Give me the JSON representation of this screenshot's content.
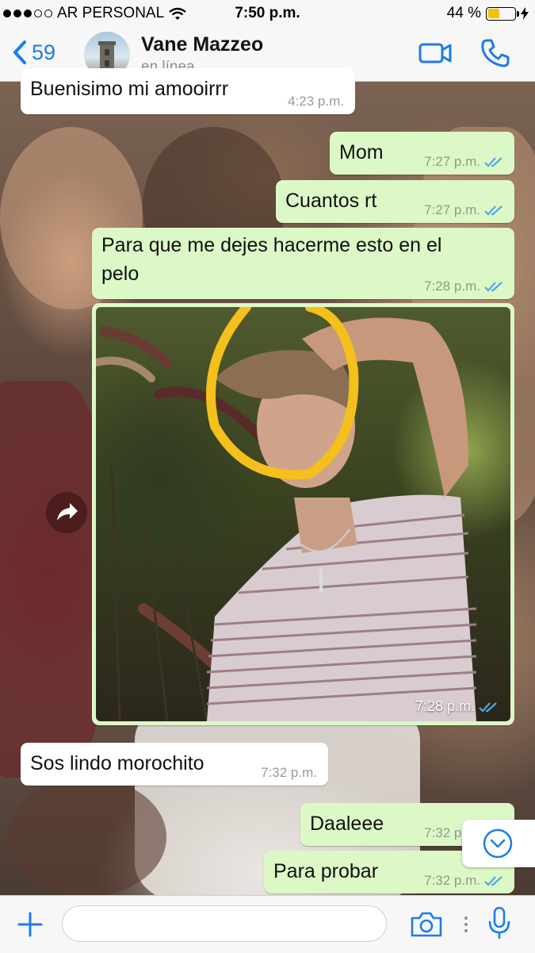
{
  "status_bar": {
    "carrier": "AR PERSONAL",
    "time": "7:50 p.m.",
    "battery": "44 %",
    "battery_level": 0.44,
    "signal_bars": 3
  },
  "header": {
    "back_count": "59",
    "contact_name": "Vane Mazzeo",
    "contact_status": "en línea"
  },
  "messages": [
    {
      "direction": "in",
      "text": "Buenisimo mi amooirrr",
      "time": "4:23 p.m."
    },
    {
      "direction": "out",
      "text": "Mom",
      "time": "7:27 p.m.",
      "read": true
    },
    {
      "direction": "out",
      "text": "Cuantos rt",
      "time": "7:27 p.m.",
      "read": true
    },
    {
      "direction": "out",
      "text_lines": [
        "Para que me dejes hacerme esto en el",
        "pelo"
      ],
      "time": "7:28 p.m.",
      "read": true
    },
    {
      "direction": "out",
      "type": "image",
      "time": "7:28 p.m.",
      "read": true
    },
    {
      "direction": "in",
      "text": "Sos lindo morochito",
      "time": "7:32 p.m."
    },
    {
      "direction": "out",
      "text": "Daaleee",
      "time": "7:32 p.m.",
      "read": true
    },
    {
      "direction": "out",
      "text": "Para probar",
      "time": "7:32 p.m.",
      "read": true
    }
  ],
  "input_bar": {
    "placeholder": ""
  },
  "colors": {
    "accent": "#1d7ce8",
    "outgoing_bubble": "#dcf8c6",
    "incoming_bubble": "#ffffff",
    "read_ticks": "#4fa9e6",
    "battery": "#f4c200",
    "highlight_circle": "#f5bf1c"
  },
  "icons": [
    "wifi-icon",
    "battery-icon",
    "charging-icon",
    "back-chevron-icon",
    "video-call-icon",
    "phone-icon",
    "forward-icon",
    "scroll-down-icon",
    "plus-icon",
    "camera-icon",
    "microphone-icon"
  ]
}
